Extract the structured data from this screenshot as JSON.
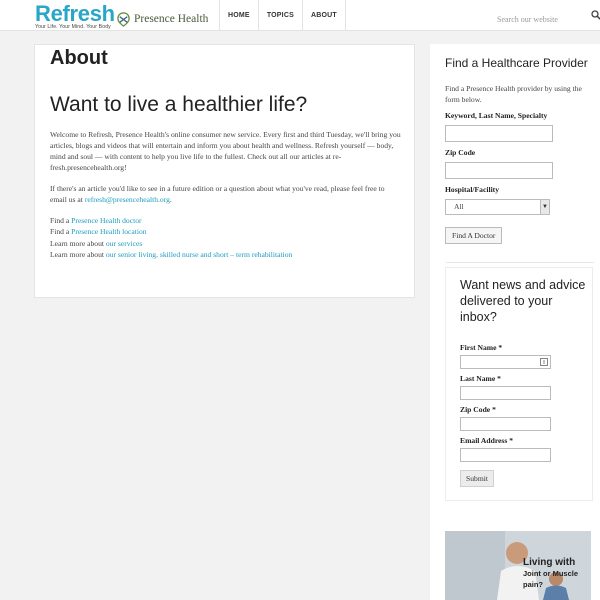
{
  "header": {
    "logo_word": "Refresh",
    "logo_tagline": "Your Life. Your Mind. Your Body",
    "partner_name": "Presence Health",
    "nav": [
      "HOME",
      "TOPICS",
      "ABOUT"
    ],
    "search_placeholder": "Search our website"
  },
  "main": {
    "page_title": "About",
    "headline": "Want to live a healthier life?",
    "intro": "Welcome to Refresh, Presence Health's online consumer new service. Every first and third Tuesday, we'll bring you articles, blogs and videos that will entertain and inform you about health and wellness. Refresh yourself — body, mind and soul — with content to help you live life to the fullest. Check out all our articles at re-fresh.presencehealth.org!",
    "contact_text": "If there's an article you'd like to see in a future edition or a question about what you've read, please feel free to email us at",
    "contact_email": "refresh@presencehealth.org",
    "contact_end": ".",
    "links": [
      {
        "prefix": "Find a ",
        "link": "Presence Health doctor"
      },
      {
        "prefix": "Find a ",
        "link": "Presence Health location"
      },
      {
        "prefix": "Learn more about ",
        "link": "our services"
      },
      {
        "prefix": "Learn more about ",
        "link": "our senior living, skilled nurse and short – term rehabilitation"
      }
    ]
  },
  "sidebar": {
    "provider": {
      "title": "Find a Healthcare Provider",
      "description": "Find a Presence Health provider by using the form below.",
      "keyword_label": "Keyword, Last Name, Specialty",
      "zip_label": "Zip Code",
      "hospital_label": "Hospital/Facility",
      "hospital_selected": "All",
      "button": "Find A Doctor"
    },
    "newsletter": {
      "title": "Want news and advice delivered to your inbox?",
      "first_name_label": "First Name *",
      "last_name_label": "Last Name *",
      "zip_label": "Zip Code *",
      "email_label": "Email Address *",
      "submit": "Submit"
    },
    "ad": {
      "line1": "Living with",
      "line2": "Joint or Muscle pain?"
    }
  },
  "colors": {
    "brand": "#2aa6c7",
    "link": "#1a9cbf",
    "partner": "#4a5b3d",
    "background": "#f2f2f2"
  }
}
